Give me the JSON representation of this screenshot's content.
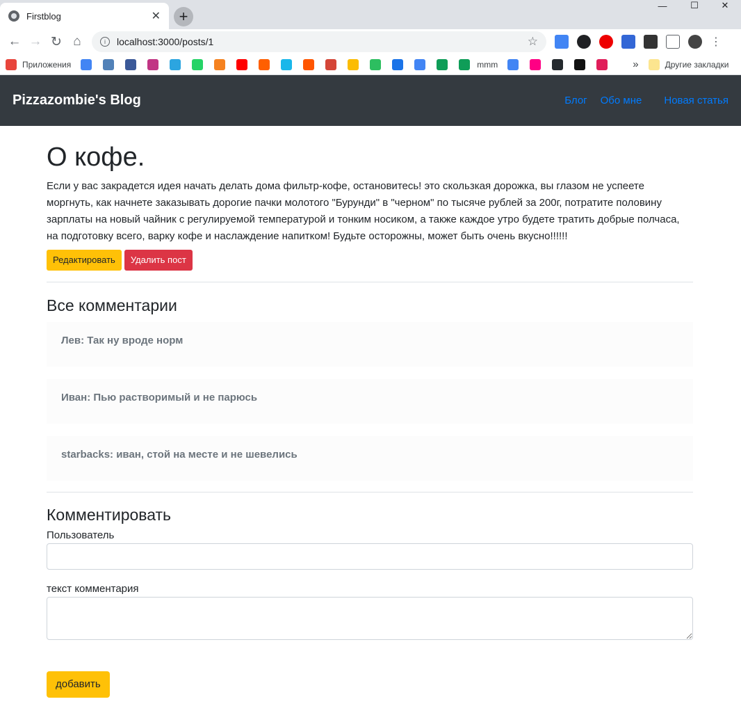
{
  "browser": {
    "tab_title": "Firstblog",
    "tab_close": "✕",
    "new_tab": "+",
    "url": "localhost:3000/posts/1",
    "star": "☆",
    "window": {
      "minimize": "—",
      "maximize": "☐",
      "close": "✕"
    },
    "nav": {
      "back": "←",
      "forward": "→",
      "reload": "↻",
      "home": "⌂"
    },
    "bookmarks": {
      "apps_label": "Приложения",
      "mmm_label": "mmm",
      "more": "»",
      "other_label": "Другие закладки"
    },
    "bookmark_colors": [
      "#4285f4",
      "#5181b8",
      "#3b5998",
      "#c13584",
      "#2ca5e0",
      "#25d366",
      "#f58220",
      "#ff0000",
      "#ff5f00",
      "#1ab7ea",
      "#ff5500",
      "#d44638",
      "#fbbc04",
      "#2dbe60",
      "#1a73e8",
      "#4285f4",
      "#0f9d58",
      "#0f9d58"
    ],
    "bookmark_colors_2": [
      "#4285f4",
      "#ff0084",
      "#24292e",
      "#111111",
      "#e01e5a"
    ]
  },
  "site": {
    "brand": "Pizzazombie's Blog",
    "nav": [
      "Блог",
      "Обо мне",
      "Новая статья"
    ]
  },
  "post": {
    "title": "О кофе.",
    "body": "Если у вас закрадется идея начать делать дома фильтр-кофе, остановитесь! это скользкая дорожка, вы глазом не успеете моргнуть, как начнете заказывать дорогие пачки молотого \"Бурунди\" в \"черном\" по тысяче рублей за 200г, потратите половину зарплаты на новый чайник с регулируемой температурой и тонким носиком, а также каждое утро будете тратить добрые полчаса, на подготовку всего, варку кофе и наслаждение напитком! Будьте осторожны, может быть очень вкусно!!!!!!",
    "edit_label": "Редактировать",
    "delete_label": "Удалить пост"
  },
  "comments": {
    "heading": "Все комментарии",
    "items": [
      "Лев: Так ну вроде норм",
      "Иван: Пью растворимый и не парюсь",
      "starbacks: иван, стой на месте и не шевелись"
    ]
  },
  "form": {
    "heading": "Комментировать",
    "user_label": "Пользователь",
    "user_value": "",
    "text_label": "текст комментария",
    "text_value": "",
    "submit_label": "добавить"
  }
}
